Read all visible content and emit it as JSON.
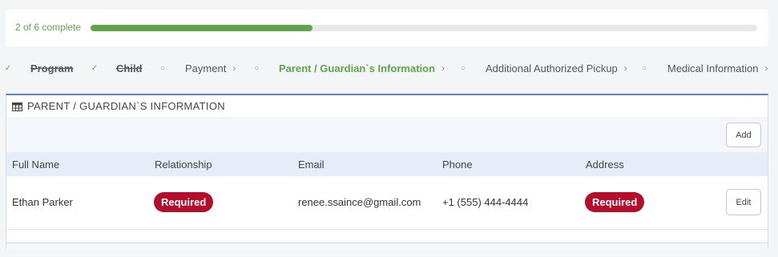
{
  "progress": {
    "text": "2 of 6 complete",
    "fraction": 0.333,
    "color": "#5fa44b"
  },
  "steps": [
    {
      "label": "Program",
      "state": "done",
      "marker": "✓",
      "chevron": ""
    },
    {
      "label": "Child",
      "state": "done",
      "marker": "✓",
      "chevron": ""
    },
    {
      "label": "Payment",
      "state": "pending",
      "marker": "○",
      "chevron": "›"
    },
    {
      "label": "Parent / Guardian`s Information",
      "state": "active",
      "marker": "○",
      "chevron": "›"
    },
    {
      "label": "Additional Authorized Pickup",
      "state": "pending",
      "marker": "○",
      "chevron": "›"
    },
    {
      "label": "Medical Information",
      "state": "pending",
      "marker": "○",
      "chevron": "›"
    }
  ],
  "panel": {
    "title": "PARENT / GUARDIAN`S INFORMATION",
    "add_label": "Add",
    "columns": [
      "Full Name",
      "Relationship",
      "Email",
      "Phone",
      "Address"
    ],
    "rows": [
      {
        "full_name": "Ethan Parker",
        "relationship": "Required",
        "email": "renee.ssaince@gmail.com",
        "phone": "+1 (555) 444-4444",
        "address": "Required",
        "edit_label": "Edit"
      }
    ]
  },
  "colors": {
    "accent": "#5fa44b",
    "badge": "#b40e2c",
    "panel_border": "#5b7fd1"
  },
  "icons": {
    "panel_header": "table-grid-icon"
  }
}
